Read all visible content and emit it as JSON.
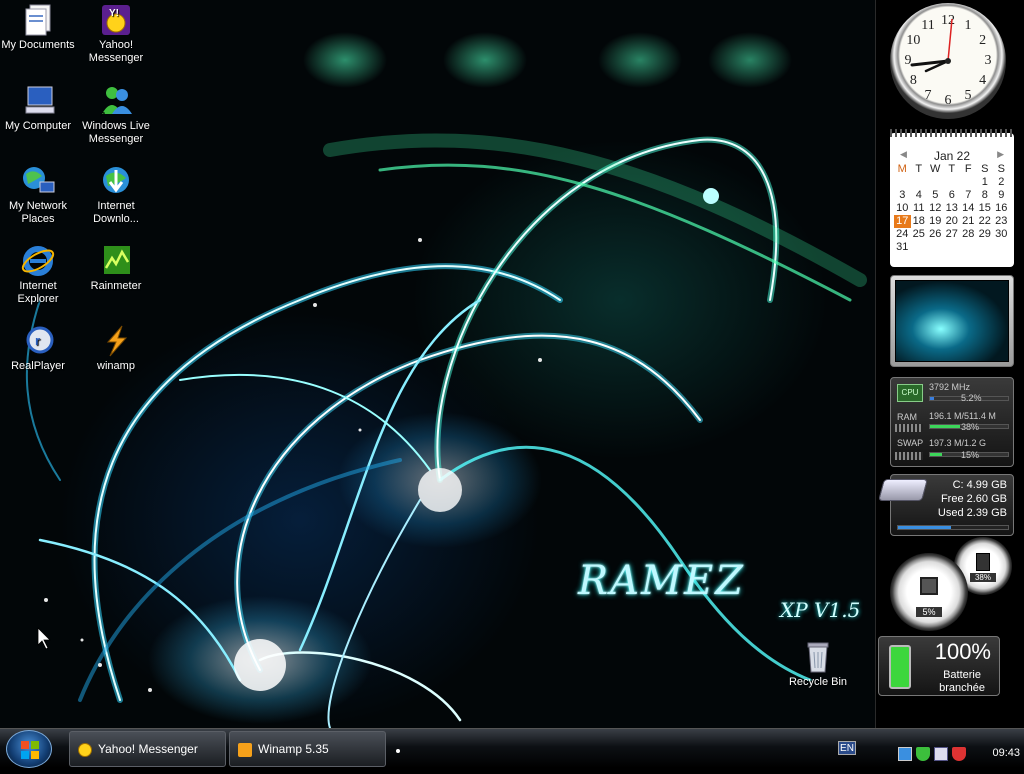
{
  "desktop": {
    "icons": [
      {
        "name": "My Documents",
        "icon": "my-documents-icon"
      },
      {
        "name": "Yahoo! Messenger",
        "icon": "yahoo-messenger-icon"
      },
      {
        "name": "My Computer",
        "icon": "my-computer-icon"
      },
      {
        "name": "Windows Live Messenger",
        "icon": "windows-live-messenger-icon"
      },
      {
        "name": "My Network Places",
        "icon": "network-places-icon"
      },
      {
        "name": "Internet Downlo...",
        "icon": "internet-download-icon"
      },
      {
        "name": "Internet Explorer",
        "icon": "internet-explorer-icon"
      },
      {
        "name": "Rainmeter",
        "icon": "rainmeter-icon"
      },
      {
        "name": "RealPlayer",
        "icon": "realplayer-icon"
      },
      {
        "name": "winamp",
        "icon": "winamp-icon"
      }
    ],
    "recycle_bin": "Recycle Bin",
    "wallpaper_text": {
      "line1": "RAMEZ",
      "line2": "XP V1.5"
    }
  },
  "sidebar": {
    "clock": {
      "numbers": [
        "12",
        "1",
        "2",
        "3",
        "4",
        "5",
        "6",
        "7",
        "8",
        "9",
        "10",
        "11"
      ]
    },
    "calendar": {
      "month": "Jan 22",
      "weekdays": [
        "M",
        "T",
        "W",
        "T",
        "F",
        "S",
        "S"
      ],
      "weeks": [
        [
          "",
          "",
          "",
          "",
          "",
          "1",
          "2"
        ],
        [
          "3",
          "4",
          "5",
          "6",
          "7",
          "8",
          "9"
        ],
        [
          "10",
          "11",
          "12",
          "13",
          "14",
          "15",
          "16"
        ],
        [
          "17",
          "18",
          "19",
          "20",
          "21",
          "22",
          "23"
        ],
        [
          "24",
          "25",
          "26",
          "27",
          "28",
          "29",
          "30"
        ],
        [
          "31",
          "",
          "",
          "",
          "",
          "",
          ""
        ]
      ],
      "today": "17"
    },
    "cpu_meter": {
      "cpu_label": "CPU",
      "cpu_freq": "3792 MHz",
      "cpu_pct": "5.2%",
      "cpu_fill": 0.052,
      "ram_label": "RAM",
      "ram_value": "196.1 M/511.4 M",
      "ram_pct": "38%",
      "ram_fill": 0.38,
      "swap_label": "SWAP",
      "swap_value": "197.3 M/1.2 G",
      "swap_pct": "15%",
      "swap_fill": 0.15
    },
    "drive": {
      "line1": "C:  4.99 GB",
      "line2": "Free 2.60 GB",
      "line3": "Used 2.39 GB",
      "used_fill": 0.48
    },
    "gauges": {
      "cpu": "5%",
      "ram": "38%"
    },
    "battery": {
      "percent": "100%",
      "line1": "Batterie",
      "line2": "branchée"
    }
  },
  "taskbar": {
    "tasks": [
      {
        "label": "Yahoo! Messenger",
        "icon": "yahoo-smiley-icon"
      },
      {
        "label": "Winamp 5.35",
        "icon": "winamp-bolt-icon"
      }
    ],
    "language": "EN",
    "time": "09:43"
  },
  "colors": {
    "accent": "#5ff0ff",
    "wallpaper_green": "#4fffb0",
    "taskbar": "#0d1014"
  }
}
